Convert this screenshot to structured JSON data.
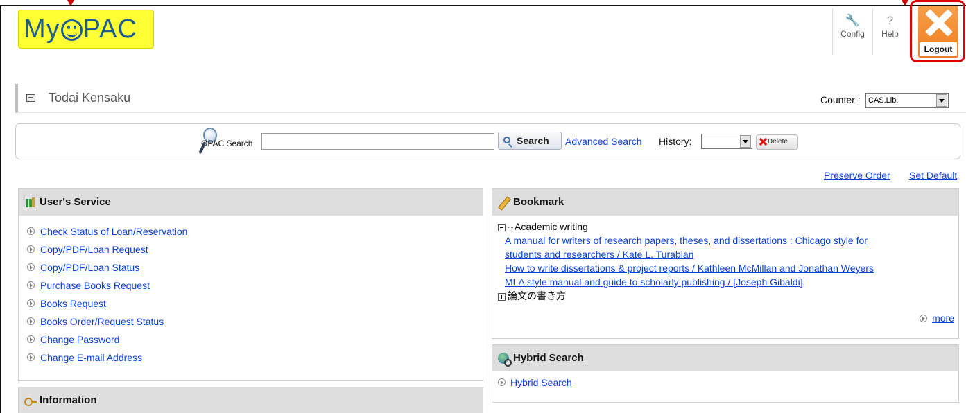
{
  "header": {
    "logo_text": "MyOPAC",
    "config_label": "Config",
    "help_label": "Help",
    "logout_label": "Logout"
  },
  "title": {
    "text": "Todai Kensaku",
    "counter_label": "Counter :",
    "counter_value": "CAS.Lib."
  },
  "search": {
    "label": "OPAC Search",
    "input_value": "",
    "button_label": "Search",
    "advanced_label": "Advanced Search",
    "history_label": "History:",
    "history_value": "",
    "delete_label": "Delete"
  },
  "layout_links": {
    "preserve_order": "Preserve Order",
    "set_default": "Set Default"
  },
  "users_service": {
    "title": "User's Service",
    "items": [
      "Check Status of Loan/Reservation",
      "Copy/PDF/Loan Request",
      "Copy/PDF/Loan Status",
      "Purchase Books Request",
      "Books Request",
      "Books Order/Request Status",
      "Change Password",
      "Change E-mail Address"
    ]
  },
  "information": {
    "title": "Information"
  },
  "bookmark": {
    "title": "Bookmark",
    "folder_open": "Academic writing",
    "items": [
      "A manual for writers of research papers, theses, and dissertations : Chicago style for",
      "students and researchers / Kate L. Turabian",
      "How to write dissertations & project reports / Kathleen McMillan and Jonathan Weyers",
      "MLA style manual and guide to scholarly publishing / [Joseph Gibaldi]"
    ],
    "folder_closed": "論文の書き方",
    "more_label": "more"
  },
  "hybrid": {
    "title": "Hybrid Search",
    "link_label": "Hybrid Search"
  },
  "colors": {
    "link": "#0b3fd8",
    "logo_bg": "#ffff33",
    "logout_bg": "#f17c1e",
    "highlight": "#e10000"
  }
}
